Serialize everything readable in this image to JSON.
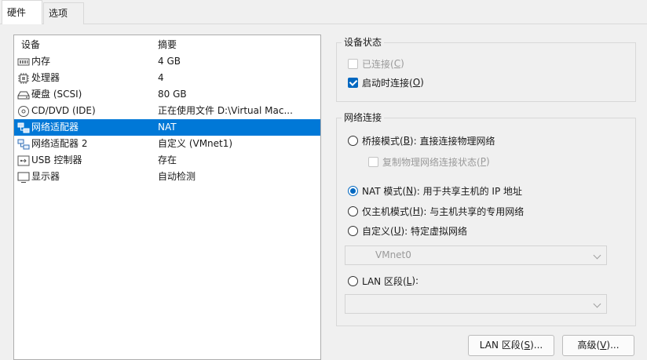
{
  "tabs": [
    {
      "label": "硬件"
    },
    {
      "label": "选项"
    }
  ],
  "device_list": {
    "columns": [
      "设备",
      "摘要"
    ],
    "rows": [
      {
        "icon": "memory-icon",
        "device": "内存",
        "summary": "4 GB"
      },
      {
        "icon": "processor-icon",
        "device": "处理器",
        "summary": "4"
      },
      {
        "icon": "harddisk-icon",
        "device": "硬盘 (SCSI)",
        "summary": "80 GB"
      },
      {
        "icon": "cd-dvd-icon",
        "device": "CD/DVD (IDE)",
        "summary": "正在使用文件 D:\\Virtual Mac..."
      },
      {
        "icon": "network-adapter-icon",
        "device": "网络适配器",
        "summary": "NAT",
        "selected": true
      },
      {
        "icon": "network-adapter-icon",
        "device": "网络适配器 2",
        "summary": "自定义 (VMnet1)"
      },
      {
        "icon": "usb-icon",
        "device": "USB 控制器",
        "summary": "存在"
      },
      {
        "icon": "display-icon",
        "device": "显示器",
        "summary": "自动检测"
      }
    ]
  },
  "device_status": {
    "title": "设备状态",
    "connected": {
      "label": "已连接(",
      "key": "C",
      "suffix": ")",
      "checked": false,
      "disabled": true
    },
    "connect_at_power_on": {
      "label": "启动时连接(",
      "key": "O",
      "suffix": ")",
      "checked": true
    }
  },
  "network_connection": {
    "title": "网络连接",
    "bridged": {
      "label": "桥接模式(",
      "key": "B",
      "suffix": "): 直接连接物理网络",
      "selected": false
    },
    "replicate": {
      "label": "复制物理网络连接状态(",
      "key": "P",
      "suffix": ")",
      "checked": false,
      "disabled": true
    },
    "nat": {
      "label": "NAT 模式(",
      "key": "N",
      "suffix": "): 用于共享主机的 IP 地址",
      "selected": true
    },
    "host_only": {
      "label": "仅主机模式(",
      "key": "H",
      "suffix": "): 与主机共享的专用网络",
      "selected": false
    },
    "custom": {
      "label": "自定义(",
      "key": "U",
      "suffix": "): 特定虚拟网络",
      "selected": false
    },
    "custom_value": "VMnet0",
    "lan_segment": {
      "label": "LAN 区段(",
      "key": "L",
      "suffix": "):",
      "selected": false
    },
    "lan_segment_value": ""
  },
  "buttons": {
    "lan_segments": {
      "label": "LAN 区段(",
      "key": "S",
      "suffix": ")..."
    },
    "advanced": {
      "label": "高级(",
      "key": "V",
      "suffix": ")..."
    }
  },
  "colors": {
    "selection": "#0078d7",
    "accent": "#0067c0"
  }
}
